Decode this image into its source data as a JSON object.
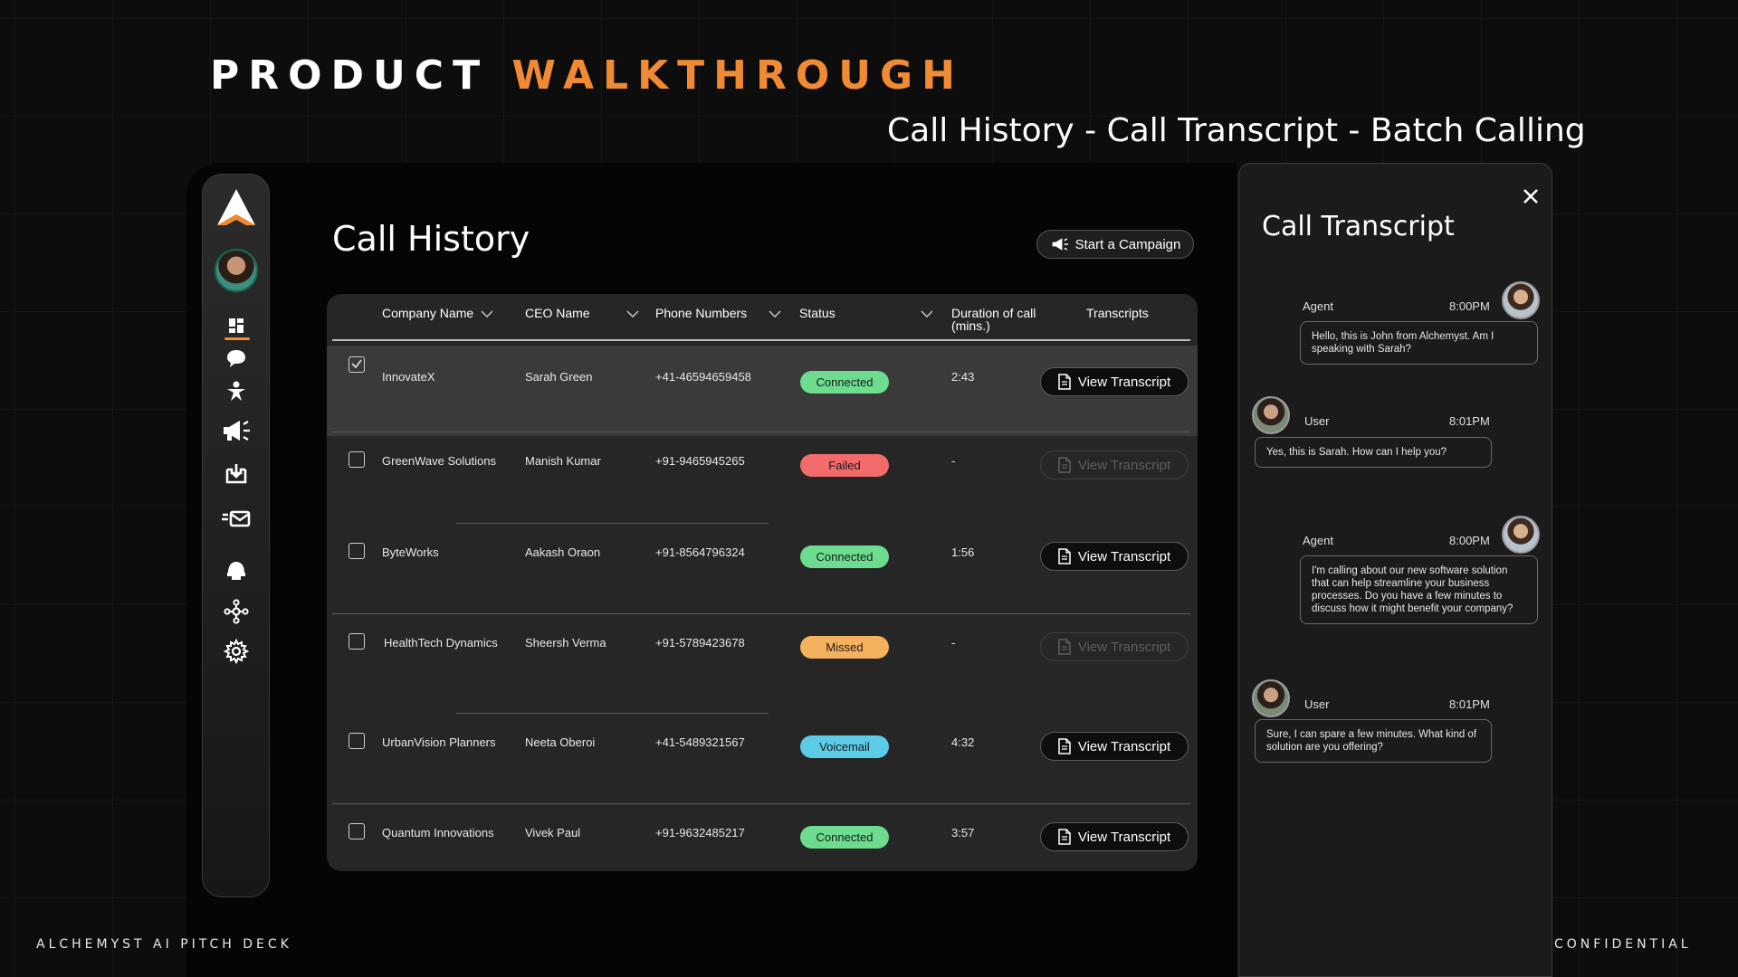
{
  "deck": {
    "title_part1": "PRODUCT",
    "title_part2": "WALKTHROUGH",
    "subtitle": "Call History - Call Transcript - Batch Calling",
    "footer_left": "ALCHEMYST AI PITCH DECK",
    "footer_right": "CONFIDENTIAL",
    "accent_color": "#f08a33"
  },
  "sidebar": {
    "items": [
      {
        "icon": "dashboard-icon"
      },
      {
        "icon": "chat-bubble-icon"
      },
      {
        "icon": "person-icon"
      },
      {
        "icon": "megaphone-icon"
      },
      {
        "icon": "inbox-download-icon"
      },
      {
        "icon": "mail-send-icon"
      },
      {
        "icon": "helmet-icon"
      },
      {
        "icon": "network-icon"
      },
      {
        "icon": "gear-icon"
      }
    ],
    "active_index": 0
  },
  "main": {
    "title": "Call History",
    "campaign_button": "Start a Campaign"
  },
  "table": {
    "columns": {
      "company": "Company Name",
      "ceo": "CEO Name",
      "phone": "Phone Numbers",
      "status": "Status",
      "duration": "Duration of call (mins.)",
      "transcripts": "Transcripts"
    },
    "rows": [
      {
        "company": "InnovateX",
        "ceo": "Sarah Green",
        "phone": "+41-46594659458",
        "status": "Connected",
        "duration": "2:43",
        "transcript": "View Transcript",
        "checked": true
      },
      {
        "company": "GreenWave Solutions",
        "ceo": "Manish Kumar",
        "phone": "+91-9465945265",
        "status": "Failed",
        "duration": "-",
        "transcript": "View Transcript",
        "checked": false
      },
      {
        "company": "ByteWorks",
        "ceo": "Aakash Oraon",
        "phone": "+91-8564796324",
        "status": "Connected",
        "duration": "1:56",
        "transcript": "View Transcript",
        "checked": false
      },
      {
        "company": "HealthTech Dynamics",
        "ceo": "Sheersh Verma",
        "phone": "+91-5789423678",
        "status": "Missed",
        "duration": "-",
        "transcript": "View Transcript",
        "checked": false
      },
      {
        "company": "UrbanVision Planners",
        "ceo": "Neeta Oberoi",
        "phone": "+41-5489321567",
        "status": "Voicemail",
        "duration": "4:32",
        "transcript": "View Transcript",
        "checked": false
      },
      {
        "company": "Quantum Innovations",
        "ceo": "Vivek Paul",
        "phone": "+91-9632485217",
        "status": "Connected",
        "duration": "3:57",
        "transcript": "View Transcript",
        "checked": false
      }
    ],
    "status_colors": {
      "Connected": "#6ddc8f",
      "Failed": "#f26b6b",
      "Missed": "#f6b15f",
      "Voicemail": "#5ccbe6"
    }
  },
  "transcript": {
    "title": "Call Transcript",
    "messages": [
      {
        "role": "Agent",
        "time": "8:00PM",
        "text": "Hello, this is John from Alchemyst. Am I speaking with Sarah?"
      },
      {
        "role": "User",
        "time": "8:01PM",
        "text": "Yes, this is Sarah. How can I help you?"
      },
      {
        "role": "Agent",
        "time": "8:00PM",
        "text": "I'm calling about our new software solution that can help streamline your business processes. Do you have a few minutes to discuss how it might benefit your company?"
      },
      {
        "role": "User",
        "time": "8:01PM",
        "text": "Sure, I can spare a few minutes. What kind of solution are you offering?"
      }
    ]
  }
}
